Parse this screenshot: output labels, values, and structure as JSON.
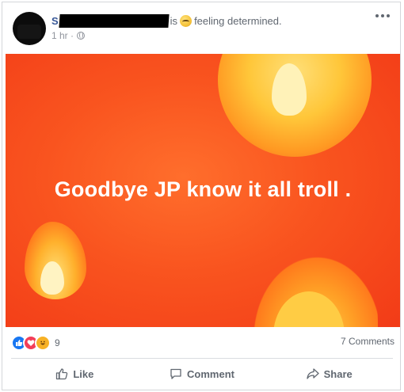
{
  "post": {
    "author_initial": "S",
    "verb": "is",
    "feeling": "feeling determined.",
    "time": "1 hr ·",
    "media_text": "Goodbye JP know it all troll ."
  },
  "reactions": {
    "icons": [
      "like-icon",
      "love-icon",
      "haha-icon"
    ],
    "count": "9",
    "comments": "7 Comments"
  },
  "actions": {
    "like": "Like",
    "comment": "Comment",
    "share": "Share"
  },
  "colors": {
    "background_start": "#ff6e2c",
    "background_end": "#f23b17",
    "link_blue": "#385898",
    "muted_text": "#606770"
  }
}
